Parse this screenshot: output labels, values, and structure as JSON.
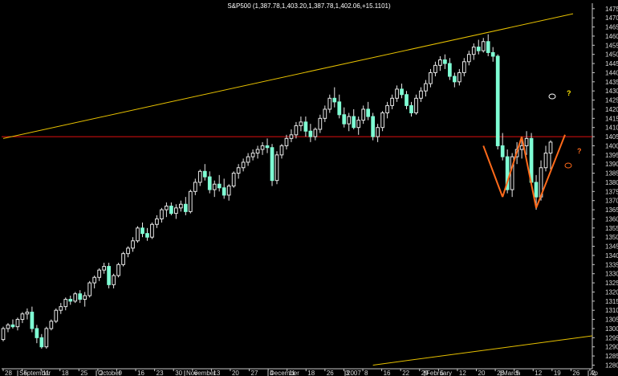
{
  "title": "S&P500 (1,387.78,1,403.20,1,387.78,1,402.06,+15.1101)",
  "colors": {
    "background": "#000000",
    "candle": "#7fffd4",
    "wick": "#e8e8e8",
    "channel": "#e6c000",
    "resistance": "#e01010",
    "pattern": "#ff6a1a",
    "annot_yellow": "#ffe600",
    "annot_orange": "#ff6a1a",
    "axis": "#c8c8c8"
  },
  "annotations": {
    "q1": "?",
    "q2": "?"
  },
  "chart_data": {
    "type": "candlestick",
    "title": "S&P500 (1,387.78,1,403.20,1,387.78,1,402.06,+15.1101)",
    "y_ticks": [
      1280,
      1285,
      1290,
      1295,
      1300,
      1305,
      1310,
      1315,
      1320,
      1325,
      1330,
      1335,
      1340,
      1345,
      1350,
      1355,
      1360,
      1365,
      1370,
      1375,
      1380,
      1385,
      1390,
      1395,
      1400,
      1405,
      1410,
      1415,
      1420,
      1425,
      1430,
      1435,
      1440,
      1445,
      1450,
      1455,
      1460,
      1465,
      1470,
      1475
    ],
    "ylim": [
      1278,
      1478
    ],
    "x_day_ticks": [
      "28",
      "5",
      "11",
      "18",
      "25",
      "2",
      "9",
      "16",
      "23",
      "30",
      "6",
      "13",
      "20",
      "27",
      "4",
      "11",
      "18",
      "26",
      "3",
      "8",
      "16",
      "22",
      "29",
      "5",
      "12",
      "20",
      "26",
      "5",
      "12",
      "19",
      "26",
      "2"
    ],
    "months": [
      "September",
      "October",
      "November",
      "December",
      "2007",
      "February",
      "March",
      "Ap"
    ],
    "ohlc": [
      [
        1294,
        1301,
        1293,
        1300
      ],
      [
        1300,
        1303,
        1298,
        1302
      ],
      [
        1302,
        1305,
        1300,
        1301
      ],
      [
        1301,
        1306,
        1299,
        1305
      ],
      [
        1305,
        1309,
        1303,
        1308
      ],
      [
        1308,
        1311,
        1305,
        1309
      ],
      [
        1309,
        1312,
        1298,
        1300
      ],
      [
        1300,
        1302,
        1292,
        1295
      ],
      [
        1295,
        1297,
        1289,
        1290
      ],
      [
        1290,
        1301,
        1289,
        1300
      ],
      [
        1300,
        1305,
        1299,
        1304
      ],
      [
        1304,
        1311,
        1303,
        1310
      ],
      [
        1310,
        1314,
        1308,
        1312
      ],
      [
        1312,
        1317,
        1310,
        1316
      ],
      [
        1316,
        1318,
        1313,
        1315
      ],
      [
        1315,
        1320,
        1314,
        1319
      ],
      [
        1319,
        1321,
        1314,
        1316
      ],
      [
        1316,
        1320,
        1312,
        1318
      ],
      [
        1318,
        1326,
        1317,
        1325
      ],
      [
        1325,
        1329,
        1322,
        1328
      ],
      [
        1328,
        1333,
        1326,
        1332
      ],
      [
        1332,
        1336,
        1330,
        1334
      ],
      [
        1334,
        1336,
        1322,
        1324
      ],
      [
        1324,
        1330,
        1322,
        1329
      ],
      [
        1329,
        1336,
        1328,
        1335
      ],
      [
        1335,
        1342,
        1334,
        1341
      ],
      [
        1341,
        1345,
        1339,
        1344
      ],
      [
        1344,
        1350,
        1342,
        1348
      ],
      [
        1348,
        1356,
        1347,
        1355
      ],
      [
        1355,
        1358,
        1350,
        1352
      ],
      [
        1352,
        1355,
        1348,
        1350
      ],
      [
        1350,
        1358,
        1349,
        1357
      ],
      [
        1357,
        1362,
        1355,
        1360
      ],
      [
        1360,
        1366,
        1358,
        1365
      ],
      [
        1365,
        1369,
        1361,
        1367
      ],
      [
        1367,
        1369,
        1362,
        1363
      ],
      [
        1363,
        1368,
        1360,
        1366
      ],
      [
        1366,
        1370,
        1364,
        1368
      ],
      [
        1368,
        1372,
        1362,
        1364
      ],
      [
        1364,
        1376,
        1363,
        1375
      ],
      [
        1375,
        1382,
        1373,
        1380
      ],
      [
        1380,
        1387,
        1378,
        1386
      ],
      [
        1386,
        1390,
        1381,
        1383
      ],
      [
        1383,
        1386,
        1374,
        1376
      ],
      [
        1376,
        1381,
        1372,
        1379
      ],
      [
        1379,
        1384,
        1375,
        1377
      ],
      [
        1377,
        1382,
        1371,
        1373
      ],
      [
        1373,
        1379,
        1370,
        1378
      ],
      [
        1378,
        1386,
        1377,
        1385
      ],
      [
        1385,
        1390,
        1382,
        1388
      ],
      [
        1388,
        1393,
        1386,
        1391
      ],
      [
        1391,
        1396,
        1389,
        1394
      ],
      [
        1394,
        1398,
        1392,
        1396
      ],
      [
        1396,
        1400,
        1393,
        1398
      ],
      [
        1398,
        1402,
        1395,
        1400
      ],
      [
        1400,
        1404,
        1396,
        1399
      ],
      [
        1399,
        1401,
        1378,
        1381
      ],
      [
        1381,
        1397,
        1379,
        1395
      ],
      [
        1395,
        1401,
        1393,
        1400
      ],
      [
        1400,
        1406,
        1398,
        1404
      ],
      [
        1404,
        1409,
        1402,
        1406
      ],
      [
        1406,
        1413,
        1404,
        1411
      ],
      [
        1411,
        1416,
        1408,
        1413
      ],
      [
        1413,
        1416,
        1405,
        1408
      ],
      [
        1408,
        1412,
        1402,
        1405
      ],
      [
        1405,
        1410,
        1403,
        1409
      ],
      [
        1409,
        1417,
        1407,
        1415
      ],
      [
        1415,
        1422,
        1413,
        1420
      ],
      [
        1420,
        1428,
        1418,
        1426
      ],
      [
        1426,
        1432,
        1421,
        1424
      ],
      [
        1424,
        1428,
        1415,
        1417
      ],
      [
        1417,
        1421,
        1410,
        1412
      ],
      [
        1412,
        1418,
        1408,
        1416
      ],
      [
        1416,
        1420,
        1409,
        1410
      ],
      [
        1410,
        1416,
        1406,
        1414
      ],
      [
        1414,
        1422,
        1412,
        1420
      ],
      [
        1420,
        1424,
        1414,
        1416
      ],
      [
        1416,
        1418,
        1403,
        1405
      ],
      [
        1405,
        1412,
        1402,
        1410
      ],
      [
        1410,
        1419,
        1408,
        1418
      ],
      [
        1418,
        1424,
        1415,
        1422
      ],
      [
        1422,
        1428,
        1420,
        1426
      ],
      [
        1426,
        1433,
        1424,
        1431
      ],
      [
        1431,
        1434,
        1426,
        1428
      ],
      [
        1428,
        1430,
        1420,
        1422
      ],
      [
        1422,
        1424,
        1416,
        1418
      ],
      [
        1418,
        1428,
        1417,
        1426
      ],
      [
        1426,
        1432,
        1424,
        1430
      ],
      [
        1430,
        1436,
        1427,
        1434
      ],
      [
        1434,
        1442,
        1432,
        1440
      ],
      [
        1440,
        1446,
        1438,
        1444
      ],
      [
        1444,
        1449,
        1441,
        1447
      ],
      [
        1447,
        1450,
        1442,
        1445
      ],
      [
        1445,
        1448,
        1436,
        1438
      ],
      [
        1438,
        1440,
        1432,
        1435
      ],
      [
        1435,
        1442,
        1433,
        1440
      ],
      [
        1440,
        1448,
        1438,
        1446
      ],
      [
        1446,
        1452,
        1444,
        1450
      ],
      [
        1450,
        1456,
        1447,
        1454
      ],
      [
        1454,
        1458,
        1450,
        1452
      ],
      [
        1452,
        1459,
        1451,
        1457
      ],
      [
        1457,
        1461,
        1449,
        1451
      ],
      [
        1451,
        1454,
        1446,
        1449
      ],
      [
        1449,
        1450,
        1398,
        1400
      ],
      [
        1400,
        1407,
        1392,
        1394
      ],
      [
        1394,
        1398,
        1374,
        1376
      ],
      [
        1376,
        1396,
        1372,
        1394
      ],
      [
        1394,
        1402,
        1390,
        1398
      ],
      [
        1398,
        1405,
        1393,
        1400
      ],
      [
        1400,
        1408,
        1395,
        1404
      ],
      [
        1404,
        1407,
        1378,
        1380
      ],
      [
        1380,
        1384,
        1365,
        1372
      ],
      [
        1372,
        1392,
        1370,
        1388
      ],
      [
        1388,
        1400,
        1386,
        1396
      ],
      [
        1396,
        1403,
        1387,
        1402
      ]
    ],
    "channel_upper": [
      [
        0,
        1404
      ],
      [
        115,
        1472
      ]
    ],
    "channel_lower": [
      [
        77,
        1280
      ],
      [
        115,
        1296
      ]
    ],
    "resistance_level": 1405,
    "pattern_lines": [
      [
        [
          100,
          1400
        ],
        [
          104,
          1372
        ]
      ],
      [
        [
          104,
          1372
        ],
        [
          108,
          1405
        ]
      ],
      [
        [
          108,
          1405
        ],
        [
          111,
          1366
        ]
      ],
      [
        [
          111,
          1366
        ],
        [
          115,
          1406
        ]
      ]
    ]
  }
}
